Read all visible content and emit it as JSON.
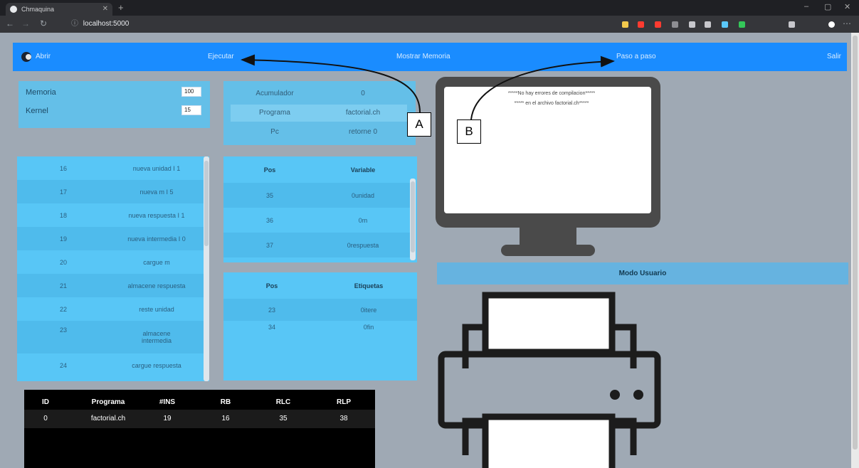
{
  "browser": {
    "tab_title": "Chmaquina",
    "url": "localhost:5000",
    "new_tab": "+",
    "win_min": "–",
    "win_max": "▢",
    "win_close": "✕",
    "ext_colors": [
      "#f2c94c",
      "#ff3b30",
      "#ff3b30",
      "#8e8e93",
      "#c7c7cc",
      "#c7c7cc",
      "#5ac8fa",
      "#34c759",
      "#c7c7cc",
      "#ffffff"
    ]
  },
  "menu": {
    "abrir": "Abrir",
    "ejecutar": "Ejecutar",
    "mostrar_memoria": "Mostrar Memoria",
    "paso": "Paso a paso",
    "salir": "Salir"
  },
  "config": {
    "memoria_label": "Memoria",
    "memoria_value": "100",
    "kernel_label": "Kernel",
    "kernel_value": "15"
  },
  "registers": [
    {
      "label": "Acumulador",
      "value": "0"
    },
    {
      "label": "Programa",
      "value": "factorial.ch"
    },
    {
      "label": "Pc",
      "value": "retorne 0"
    }
  ],
  "memory": [
    {
      "pos": "16",
      "inst": "nueva unidad I 1"
    },
    {
      "pos": "17",
      "inst": "nueva m I 5"
    },
    {
      "pos": "18",
      "inst": "nueva respuesta I 1"
    },
    {
      "pos": "19",
      "inst": "nueva intermedia I 0"
    },
    {
      "pos": "20",
      "inst": "cargue m"
    },
    {
      "pos": "21",
      "inst": "almacene respuesta"
    },
    {
      "pos": "22",
      "inst": "reste unidad"
    },
    {
      "pos": "23",
      "inst": "almacene intermedia"
    },
    {
      "pos": "24",
      "inst": "cargue respuesta"
    }
  ],
  "variables": {
    "head_pos": "Pos",
    "head_name": "Variable",
    "rows": [
      {
        "pos": "35",
        "name": "0unidad"
      },
      {
        "pos": "36",
        "name": "0m"
      },
      {
        "pos": "37",
        "name": "0respuesta"
      }
    ]
  },
  "labels": {
    "head_pos": "Pos",
    "head_name": "Etiquetas",
    "rows": [
      {
        "pos": "23",
        "name": "0itere"
      },
      {
        "pos": "34",
        "name": "0fin"
      }
    ]
  },
  "processes": {
    "headers": [
      "ID",
      "Programa",
      "#INS",
      "RB",
      "RLC",
      "RLP"
    ],
    "rows": [
      [
        "0",
        "factorial.ch",
        "19",
        "16",
        "35",
        "38"
      ]
    ]
  },
  "console": {
    "line1": "*****No hay errores de compilacion*****",
    "line2": "***** en el archivo factorial.ch*****"
  },
  "modo": "Modo Usuario",
  "callouts": {
    "a": "A",
    "b": "B"
  }
}
